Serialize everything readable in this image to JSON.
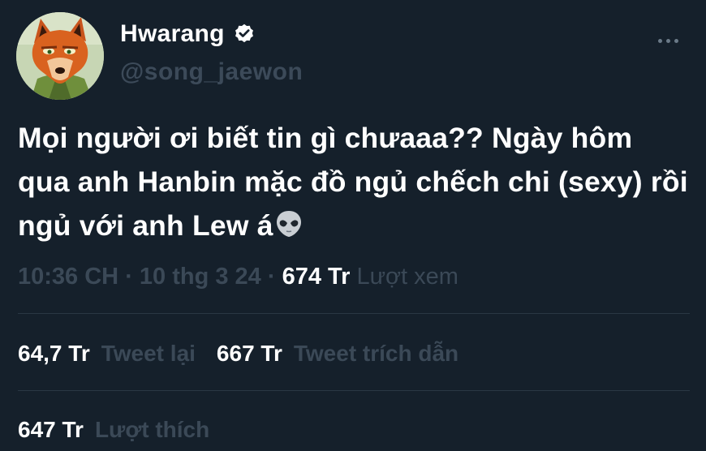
{
  "user": {
    "display_name": "Hwarang",
    "handle": "@song_jaewon",
    "verified": true
  },
  "tweet": {
    "text": "Mọi người ơi biết tin gì chưaaa?? Ngày hôm qua anh Hanbin mặc đồ ngủ chếch chi (sexy) rồi ngủ với anh Lew á",
    "emoji": "alien-icon"
  },
  "meta": {
    "time": "10:36 CH",
    "date": "10 thg 3 24",
    "views_count": "674 Tr",
    "views_label": "Lượt xem"
  },
  "stats": {
    "retweets_count": "64,7 Tr",
    "retweets_label": "Tweet lại",
    "quotes_count": "667 Tr",
    "quotes_label": "Tweet trích dẫn",
    "likes_count": "647 Tr",
    "likes_label": "Lượt thích"
  },
  "colors": {
    "background": "#15202b",
    "text": "#ffffff",
    "muted": "#3b4957",
    "divider": "#2a3744"
  }
}
